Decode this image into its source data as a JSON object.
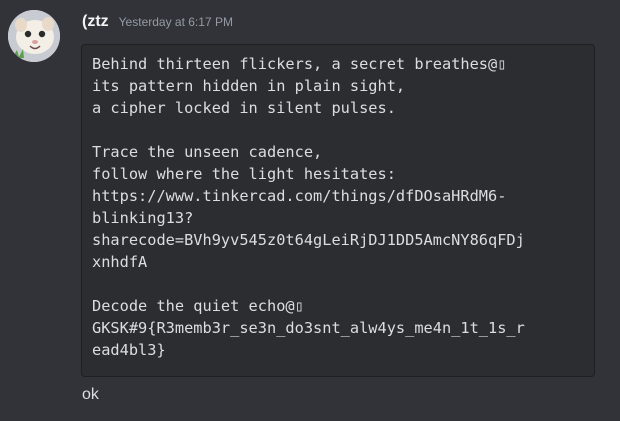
{
  "message": {
    "avatar_icon": "cat-avatar-icon",
    "author": "(ztz",
    "timestamp": "Yesterday at 6:17 PM",
    "code_lines": [
      "Behind thirteen flickers, a secret breathes@▯",
      "its pattern hidden in plain sight,",
      "a cipher locked in silent pulses.",
      "",
      "Trace the unseen cadence,",
      "follow where the light hesitates:",
      "https://www.tinkercad.com/things/dfDOsaHRdM6-",
      "blinking13?",
      "sharecode=BVh9yv545z0t64gLeiRjDJ1DD5AmcNY86qFDj",
      "xnhdfA",
      "",
      "Decode the quiet echo@▯",
      "GKSK#9{R3memb3r_se3n_do3snt_alw4ys_me4n_1t_1s_r",
      "ead4bl3}"
    ]
  },
  "followup": {
    "text": "ok"
  },
  "colors": {
    "background": "#313338",
    "codeblock_background": "#2b2d31",
    "text": "#dbdee1",
    "muted": "#949ba4"
  }
}
